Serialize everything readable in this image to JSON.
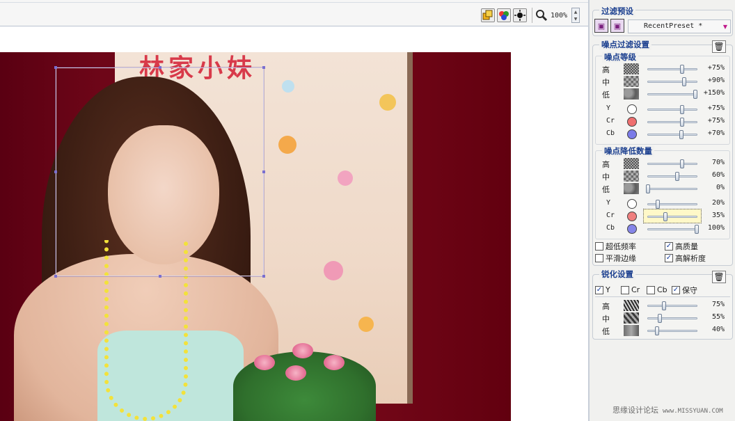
{
  "toolbar": {
    "zoom_value": "100%",
    "icons": [
      "layers-icon",
      "color-balls-icon",
      "sun-settings-icon",
      "zoom-icon"
    ]
  },
  "photo": {
    "poster_text": "林家小妹"
  },
  "presets": {
    "title": "过滤预设",
    "selected": "RecentPreset *"
  },
  "noise_filter": {
    "title": "噪点过滤设置",
    "noise_level": {
      "title": "噪点等级",
      "rows": [
        {
          "label": "高",
          "value": "+75%",
          "level": 0.7
        },
        {
          "label": "中",
          "value": "+90%",
          "level": 0.74
        },
        {
          "label": "低",
          "value": "+150%",
          "level": 0.97
        },
        {
          "label": "Y",
          "value": "+75%",
          "level": 0.7,
          "color": "#ffffff"
        },
        {
          "label": "Cr",
          "value": "+75%",
          "level": 0.7,
          "color": "#ef6f6f"
        },
        {
          "label": "Cb",
          "value": "+70%",
          "level": 0.68,
          "color": "#7b7be8"
        }
      ]
    },
    "noise_reduction": {
      "title": "噪点降低数量",
      "rows": [
        {
          "label": "高",
          "value": "70%",
          "level": 0.7
        },
        {
          "label": "中",
          "value": "60%",
          "level": 0.6
        },
        {
          "label": "低",
          "value": "0%",
          "level": 0.0
        },
        {
          "label": "Y",
          "value": "20%",
          "level": 0.2,
          "color": "#ffffff"
        },
        {
          "label": "Cr",
          "value": "35%",
          "level": 0.35,
          "color": "#ef7f7f"
        },
        {
          "label": "Cb",
          "value": "100%",
          "level": 1.0,
          "color": "#8585e8"
        }
      ]
    },
    "options": [
      {
        "label": "超低频率",
        "checked": false
      },
      {
        "label": "高质量",
        "checked": true
      },
      {
        "label": "平滑边缘",
        "checked": false
      },
      {
        "label": "高解析度",
        "checked": true
      }
    ]
  },
  "sharpen": {
    "title": "锐化设置",
    "channels": [
      {
        "label": "Y",
        "checked": true
      },
      {
        "label": "Cr",
        "checked": false
      },
      {
        "label": "Cb",
        "checked": false
      },
      {
        "label": "保守",
        "checked": true
      }
    ],
    "rows": [
      {
        "label": "高",
        "value": "75%",
        "level": 0.33
      },
      {
        "label": "中",
        "value": "55%",
        "level": 0.24
      },
      {
        "label": "低",
        "value": "40%",
        "level": 0.18
      }
    ]
  },
  "watermark": {
    "text": "思缘设计论坛",
    "url": "www.MISSYUAN.COM"
  }
}
